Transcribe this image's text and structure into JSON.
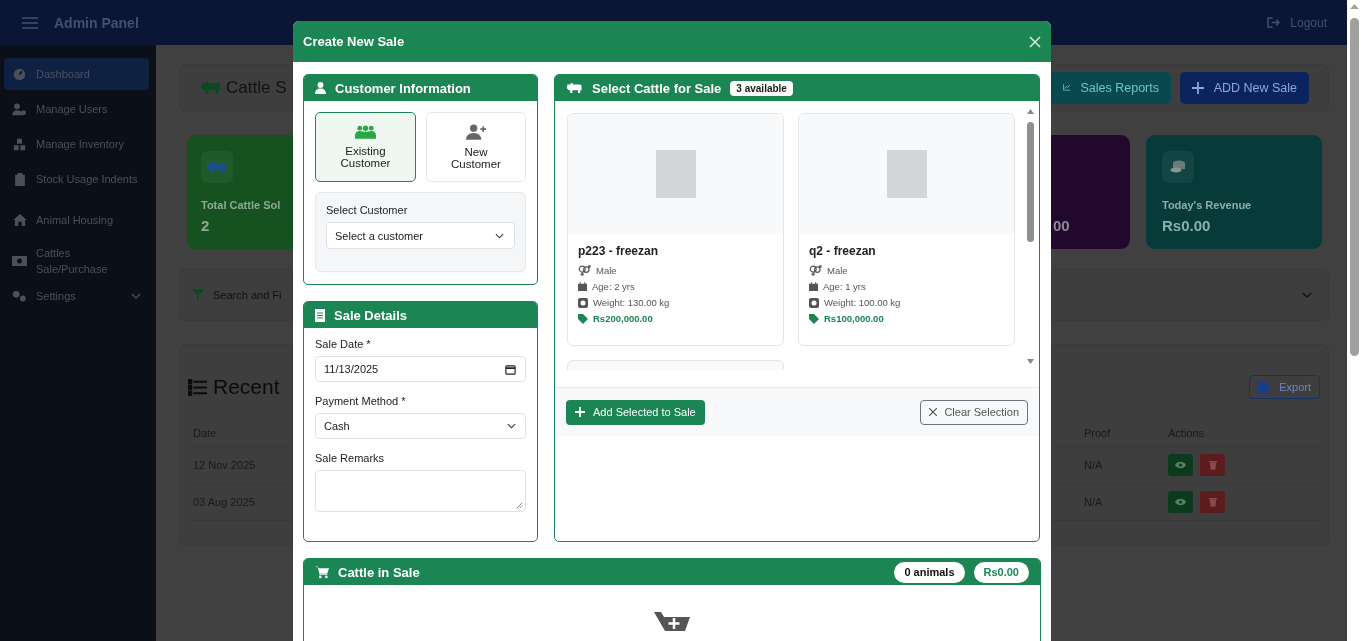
{
  "top_bar": {
    "title": "Admin Panel",
    "logout": "Logout"
  },
  "sidebar": {
    "items": [
      {
        "label": "Dashboard",
        "selected": true
      },
      {
        "label": "Manage Users",
        "selected": false
      },
      {
        "label": "Manage Inventory",
        "selected": false
      },
      {
        "label": "Stock Usage Indents",
        "selected": false
      },
      {
        "label": "Animal Housing",
        "selected": false
      },
      {
        "label": "Cattles Sale/Purchase",
        "selected": false
      },
      {
        "label": "Settings",
        "selected": false,
        "expanded": false
      }
    ]
  },
  "page": {
    "title": "Cattle S",
    "buttons": [
      {
        "label": "Sales Reports",
        "kind": "reports"
      },
      {
        "label": "ADD New Sale",
        "kind": "add"
      }
    ],
    "stats": [
      {
        "label": "Total Cattle Sol",
        "value": "2",
        "color": "#15521f"
      },
      {
        "value": "00",
        "color": "#23082e"
      },
      {
        "label": "Today's Revenue",
        "value": "Rs0.00",
        "color": "#063b39"
      }
    ],
    "filter": "Search and Fi",
    "recent_title": "Recent",
    "export": "Export",
    "table": {
      "columns": [
        "Date",
        "Proof",
        "Actions"
      ],
      "rows": [
        {
          "date": "12 Nov 2025",
          "proof": "N/A"
        },
        {
          "date": "03 Aug 2025",
          "proof": "N/A"
        }
      ]
    }
  },
  "modal": {
    "title": "Create New Sale",
    "customer": {
      "title": "Customer Information",
      "options": [
        {
          "label": "Existing Customer",
          "kind": "existing",
          "selected": true
        },
        {
          "label": "New Customer",
          "kind": "new",
          "selected": false
        }
      ],
      "select_label": "Select Customer",
      "select_value": "Select a customer"
    },
    "sale_details": {
      "title": "Sale Details",
      "fields": [
        {
          "label": "Sale Date *",
          "kind": "date",
          "value": "11/13/2025"
        },
        {
          "label": "Payment Method *",
          "kind": "select",
          "value": "Cash"
        },
        {
          "label": "Sale Remarks",
          "kind": "textarea"
        }
      ]
    },
    "cattle": {
      "title": "Select Cattle for Sale",
      "badge": "3 available",
      "items": [
        {
          "name": "p223 - freezan",
          "sex": "Male",
          "age": "Age: 2 yrs",
          "weight": "Weight: 130.00 kg",
          "price": "Rs200,000.00"
        },
        {
          "name": "q2 - freezan",
          "sex": "Male",
          "age": "Age: 1 yrs",
          "weight": "Weight: 100.00 kg",
          "price": "Rs100,000.00"
        }
      ],
      "add_button": "Add Selected to Sale",
      "clear_button": "Clear Selection"
    },
    "cart": {
      "title": "Cattle in Sale",
      "count": "0 animals",
      "total": "Rs0.00"
    }
  }
}
